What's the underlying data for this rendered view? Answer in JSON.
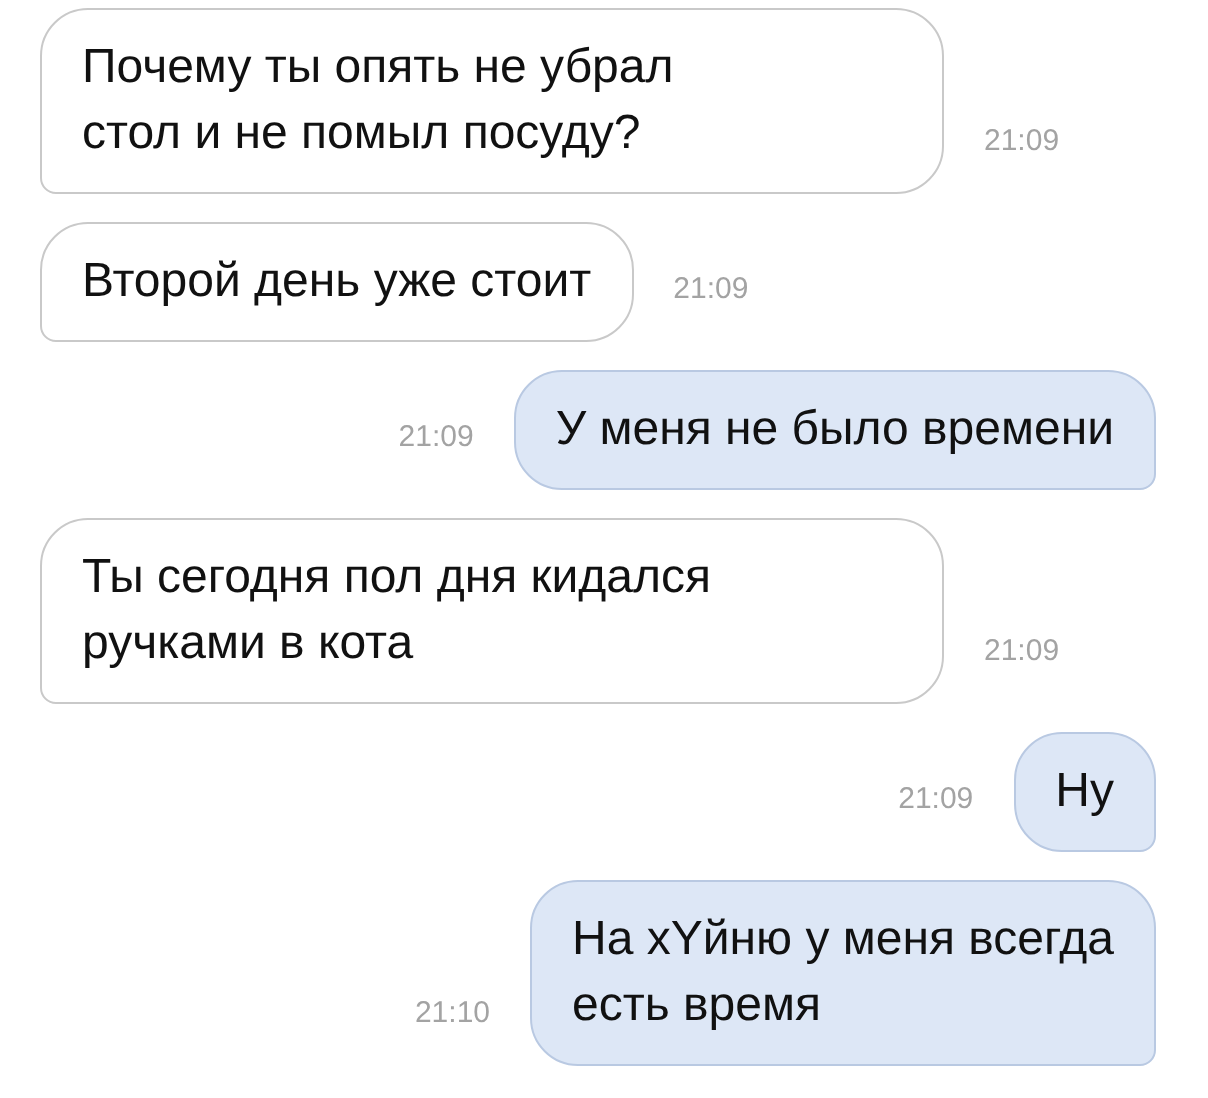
{
  "messages": [
    {
      "kind": "incoming",
      "text": "Почему ты опять не убрал\nстол и не помыл посуду?",
      "time": "21:09"
    },
    {
      "kind": "incoming",
      "text": "Второй день уже стоит",
      "time": "21:09"
    },
    {
      "kind": "outgoing",
      "text": "У меня не было времени",
      "time": "21:09"
    },
    {
      "kind": "incoming",
      "text": "Ты сегодня пол дня кидался\nручками в кота",
      "time": "21:09"
    },
    {
      "kind": "outgoing",
      "text": "Ну",
      "time": "21:09"
    },
    {
      "kind": "outgoing",
      "text": "На хYйню у меня всегда\nесть время",
      "time": "21:10"
    }
  ]
}
